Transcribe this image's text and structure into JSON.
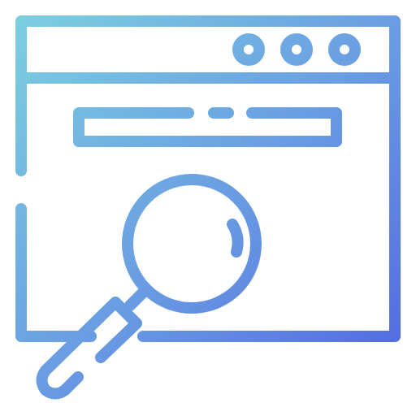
{
  "icon": {
    "name": "web-search-icon",
    "gradient": {
      "start": "#7dd3e0",
      "mid": "#6a9ee2",
      "end": "#4f5fe0"
    },
    "browser_window": {
      "buttons": [
        "window-dot-1",
        "window-dot-2",
        "window-dot-3"
      ]
    },
    "search_bar": {
      "value": ""
    }
  }
}
